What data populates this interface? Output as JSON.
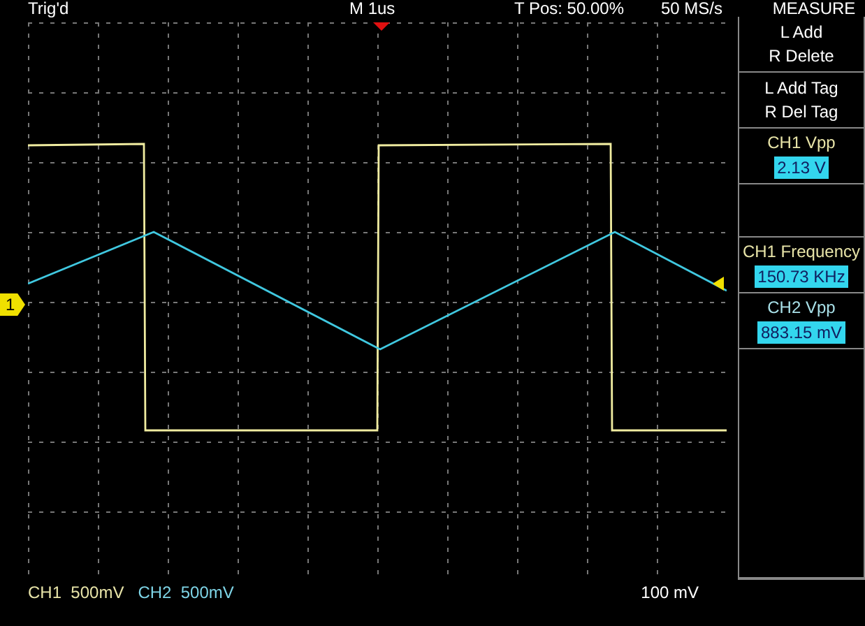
{
  "header": {
    "trigger_status": "Trig'd",
    "timebase": "M 1us",
    "trigger_position": "T Pos: 50.00%",
    "sample_rate": "50 MS/s"
  },
  "channel_marker": {
    "label": "1"
  },
  "menu": {
    "title": "MEASURE",
    "slots": [
      {
        "kind": "action",
        "lines": [
          "L Add",
          "R Delete"
        ]
      },
      {
        "kind": "action",
        "lines": [
          "L Add Tag",
          "R Del Tag"
        ]
      },
      {
        "kind": "measurement",
        "label": "CH1 Vpp",
        "value": "2.13 V",
        "color": "#e8e4a8"
      },
      {
        "kind": "empty"
      },
      {
        "kind": "measurement",
        "label": "CH1 Frequency",
        "value": "150.73 KHz",
        "color": "#e8e4a8"
      },
      {
        "kind": "measurement",
        "label": "CH2 Vpp",
        "value": "883.15 mV",
        "color": "#a8e0e8"
      },
      {
        "kind": "empty"
      }
    ]
  },
  "footer": {
    "channels": [
      {
        "name": "CH1",
        "scale": "500mV",
        "color": "#e8e4a8"
      },
      {
        "name": "CH2",
        "scale": "500mV",
        "color": "#7ed4e6"
      }
    ],
    "trigger_level": "100 mV"
  }
}
